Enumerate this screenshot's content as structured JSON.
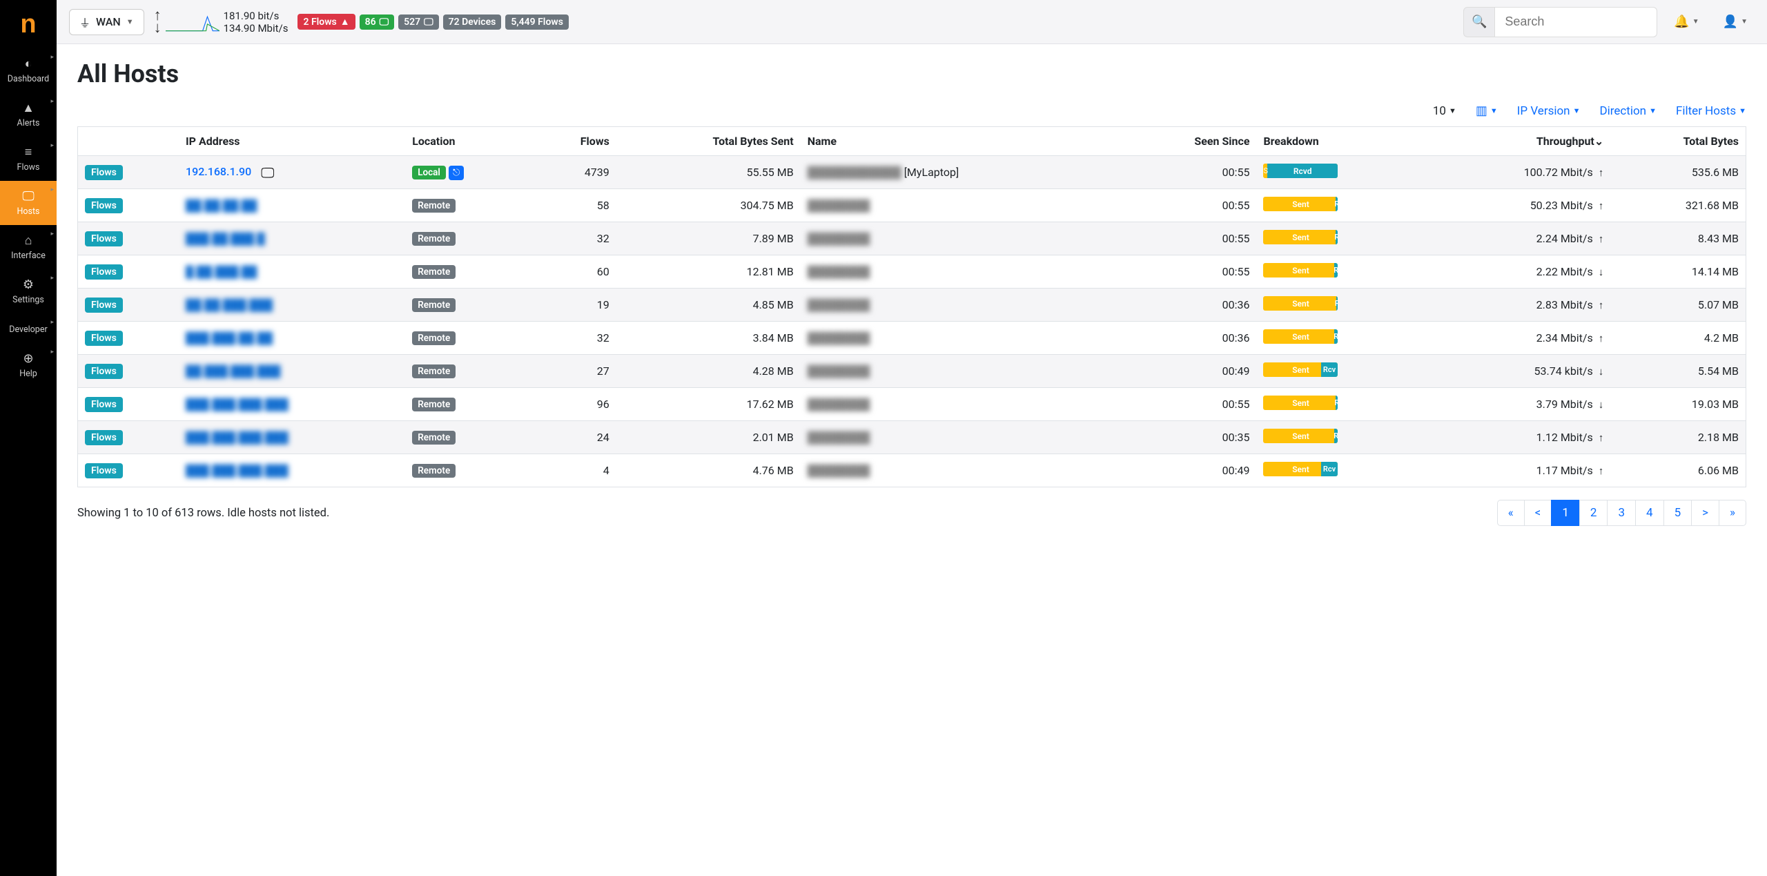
{
  "sidebar": {
    "items": [
      {
        "icon": "◐",
        "label": "Dashboard",
        "active": false
      },
      {
        "icon": "▲",
        "label": "Alerts",
        "active": false
      },
      {
        "icon": "≡",
        "label": "Flows",
        "active": false
      },
      {
        "icon": "🖵",
        "label": "Hosts",
        "active": true
      },
      {
        "icon": "⌂",
        "label": "Interface",
        "active": false
      },
      {
        "icon": "⚙",
        "label": "Settings",
        "active": false
      },
      {
        "icon": "</>",
        "label": "Developer",
        "active": false
      },
      {
        "icon": "⊕",
        "label": "Help",
        "active": false
      }
    ]
  },
  "topbar": {
    "interface": "WAN",
    "throughput_up": "181.90 bit/s",
    "throughput_down": "134.90 Mbit/s",
    "badges": {
      "flows_alert": "2 Flows",
      "green_count": "86",
      "gray1": "527",
      "devices": "72 Devices",
      "total_flows": "5,449 Flows"
    },
    "search_placeholder": "Search"
  },
  "page": {
    "title": "All Hosts",
    "page_size": "10",
    "filters": {
      "ipver": "IP Version",
      "direction": "Direction",
      "filter_hosts": "Filter Hosts"
    },
    "columns": [
      "",
      "IP Address",
      "Location",
      "Flows",
      "Total Bytes Sent",
      "Name",
      "Seen Since",
      "Breakdown",
      "Throughput",
      "Total Bytes"
    ],
    "sort_indicator": "⌄",
    "rows": [
      {
        "ip": "192.168.1.90",
        "ip_blur": false,
        "os_icons": true,
        "location": "Local",
        "tree": true,
        "flows": "4739",
        "bytes_sent": "55.55 MB",
        "name": "",
        "name_suffix": "[MyLaptop]",
        "seen": "00:55",
        "bd_sent_pct": 5,
        "bd_label": "Rcvd",
        "throughput": "100.72 Mbit/s",
        "dir": "↑",
        "total": "535.6 MB"
      },
      {
        "ip": "██.██.██.██",
        "ip_blur": true,
        "location": "Remote",
        "flows": "58",
        "bytes_sent": "304.75 MB",
        "name": "████████",
        "seen": "00:55",
        "bd_sent_pct": 97,
        "bd_label": "Sent",
        "throughput": "50.23 Mbit/s",
        "dir": "↑",
        "total": "321.68 MB"
      },
      {
        "ip": "███.██.███.█",
        "ip_blur": true,
        "location": "Remote",
        "flows": "32",
        "bytes_sent": "7.89 MB",
        "name": "████████",
        "seen": "00:55",
        "bd_sent_pct": 97,
        "bd_label": "Sent",
        "throughput": "2.24 Mbit/s",
        "dir": "↑",
        "total": "8.43 MB"
      },
      {
        "ip": "█.██.███.██",
        "ip_blur": true,
        "location": "Remote",
        "flows": "60",
        "bytes_sent": "12.81 MB",
        "name": "████████",
        "seen": "00:55",
        "bd_sent_pct": 95,
        "bd_label": "Sent",
        "throughput": "2.22 Mbit/s",
        "dir": "↓",
        "total": "14.14 MB"
      },
      {
        "ip": "██.██.███.███",
        "ip_blur": true,
        "location": "Remote",
        "flows": "19",
        "bytes_sent": "4.85 MB",
        "name": "████████",
        "seen": "00:36",
        "bd_sent_pct": 98,
        "bd_label": "Sent",
        "throughput": "2.83 Mbit/s",
        "dir": "↑",
        "total": "5.07 MB"
      },
      {
        "ip": "███.███.██.██",
        "ip_blur": true,
        "location": "Remote",
        "flows": "32",
        "bytes_sent": "3.84 MB",
        "name": "████████",
        "seen": "00:36",
        "bd_sent_pct": 95,
        "bd_label": "Sent",
        "throughput": "2.34 Mbit/s",
        "dir": "↑",
        "total": "4.2 MB"
      },
      {
        "ip": "██.███.███.███",
        "ip_blur": true,
        "location": "Remote",
        "flows": "27",
        "bytes_sent": "4.28 MB",
        "name": "████████",
        "seen": "00:49",
        "bd_sent_pct": 77,
        "bd_label": "Sent",
        "bd_rcvd_label": "Rcv",
        "throughput": "53.74 kbit/s",
        "dir": "↓",
        "total": "5.54 MB"
      },
      {
        "ip": "███.███.███.███",
        "ip_blur": true,
        "location": "Remote",
        "flows": "96",
        "bytes_sent": "17.62 MB",
        "name": "████████",
        "seen": "00:55",
        "bd_sent_pct": 97,
        "bd_label": "Sent",
        "throughput": "3.79 Mbit/s",
        "dir": "↓",
        "total": "19.03 MB"
      },
      {
        "ip": "███.███.███.███",
        "ip_blur": true,
        "location": "Remote",
        "flows": "24",
        "bytes_sent": "2.01 MB",
        "name": "████████",
        "seen": "00:35",
        "bd_sent_pct": 95,
        "bd_label": "Sent",
        "throughput": "1.12 Mbit/s",
        "dir": "↑",
        "total": "2.18 MB"
      },
      {
        "ip": "███.███.███.███",
        "ip_blur": true,
        "location": "Remote",
        "flows": "4",
        "bytes_sent": "4.76 MB",
        "name": "████████",
        "seen": "00:49",
        "bd_sent_pct": 77,
        "bd_label": "Sent",
        "bd_rcvd_label": "Rcv",
        "throughput": "1.17 Mbit/s",
        "dir": "↑",
        "total": "6.06 MB"
      }
    ],
    "footer_text": "Showing 1 to 10 of 613 rows. Idle hosts not listed.",
    "pager": [
      "«",
      "<",
      "1",
      "2",
      "3",
      "4",
      "5",
      ">",
      "»"
    ],
    "pager_active": "1"
  }
}
